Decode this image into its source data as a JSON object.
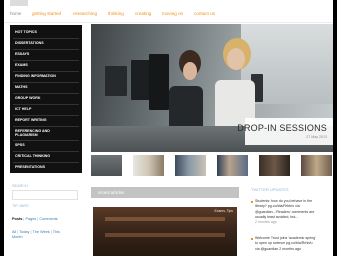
{
  "nav": {
    "items": [
      "home",
      "getting started",
      "researching",
      "thinking",
      "creating",
      "moving on",
      "contact us"
    ]
  },
  "sidebar": {
    "items": [
      "HOT TOPICS",
      "DISSERTATIONS",
      "ESSAYS",
      "EXAMS",
      "FINDING INFORMATION",
      "MATHS",
      "GROUP WORK",
      "ICT HELP",
      "REPORT WRITING",
      "REFERENCING AND PLAGIARISM",
      "SPSS",
      "CRITICAL THINKING",
      "PRESENTATIONS"
    ],
    "search_label": "SEARCH",
    "tip_label": "TIP JARS",
    "posts_bold": "Posts",
    "posts_links": [
      "Pages",
      "Comments"
    ],
    "time_links": [
      "All",
      "Today",
      "The Week",
      "This"
    ],
    "time_tail": "Month"
  },
  "hero": {
    "title": "DROP-IN SESSIONS",
    "date": "27 May 2013"
  },
  "recent": {
    "title": "recent articles",
    "tag": "Exams, Tips"
  },
  "twitter": {
    "title": "TWITTER UPDATES",
    "tweets": [
      {
        "lines": [
          "Students: how do you behave in the",
          "library? pg.co/bla/Rrhb/u via",
          "@guardian...'Readers' comments are",
          "usually least avoided, but..."
        ],
        "time": "2 months ago"
      },
      {
        "lines": [
          "Welcome Trust joins 'academic spring'",
          "to open up science pg.co/bla/Rrhb/u",
          "via @guardian 2 months ago"
        ],
        "time": ""
      }
    ]
  },
  "colors": {
    "accent": "#f0921c",
    "sidebar_bg": "#111111",
    "link": "#3a7fb5",
    "muted_blue": "#8fb8d8"
  }
}
